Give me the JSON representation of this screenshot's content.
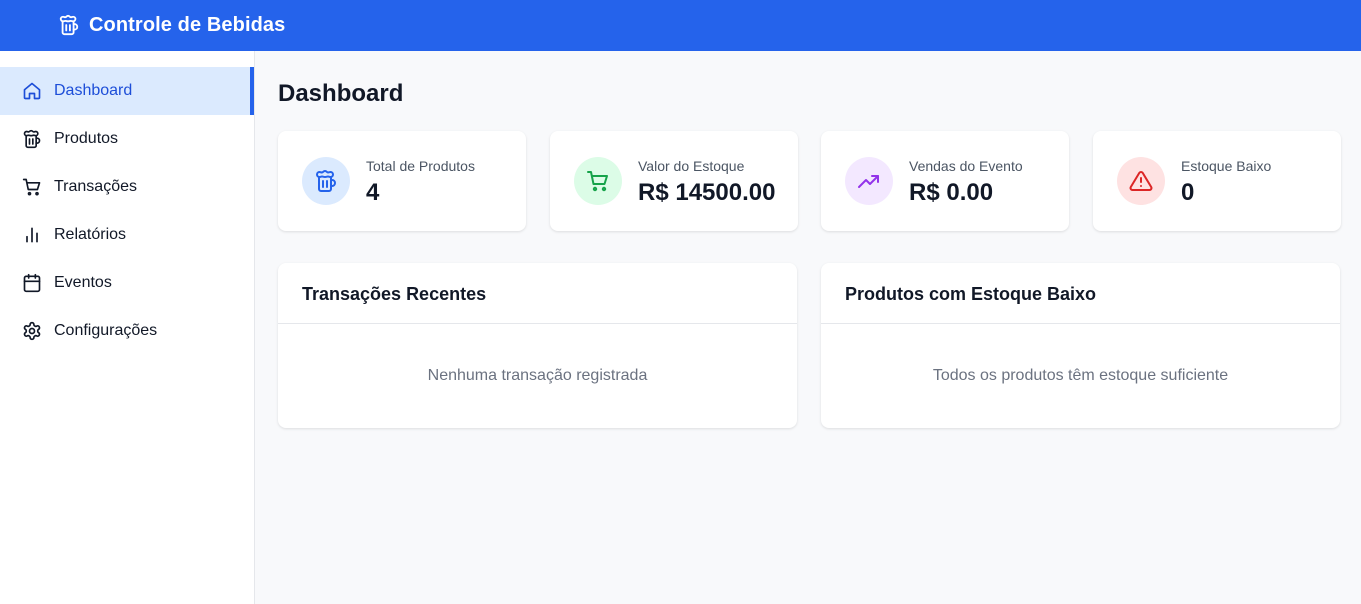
{
  "header": {
    "app_title": "Controle de Bebidas",
    "logo_icon": "beer-mug-icon",
    "background_color": "#2563eb"
  },
  "sidebar": {
    "items": [
      {
        "label": "Dashboard",
        "icon": "home-icon",
        "active": true
      },
      {
        "label": "Produtos",
        "icon": "beer-mug-icon",
        "active": false
      },
      {
        "label": "Transações",
        "icon": "shopping-cart-icon",
        "active": false
      },
      {
        "label": "Relatórios",
        "icon": "bar-chart-icon",
        "active": false
      },
      {
        "label": "Eventos",
        "icon": "calendar-icon",
        "active": false
      },
      {
        "label": "Configurações",
        "icon": "gear-icon",
        "active": false
      }
    ]
  },
  "main": {
    "page_title": "Dashboard",
    "stats": [
      {
        "label": "Total de Produtos",
        "value": "4",
        "icon": "beer-mug-icon",
        "icon_color": "#2563eb",
        "bg_color": "#dbeafe"
      },
      {
        "label": "Valor do Estoque",
        "value": "R$ 14500.00",
        "icon": "shopping-cart-icon",
        "icon_color": "#16a34a",
        "bg_color": "#dcfce7"
      },
      {
        "label": "Vendas do Evento",
        "value": "R$ 0.00",
        "icon": "trending-up-icon",
        "icon_color": "#9333ea",
        "bg_color": "#f3e8ff"
      },
      {
        "label": "Estoque Baixo",
        "value": "0",
        "icon": "warning-triangle-icon",
        "icon_color": "#dc2626",
        "bg_color": "#fee2e2"
      }
    ],
    "panels": [
      {
        "title": "Transações Recentes",
        "empty_text": "Nenhuma transação registrada"
      },
      {
        "title": "Produtos com Estoque Baixo",
        "empty_text": "Todos os produtos têm estoque suficiente"
      }
    ]
  }
}
